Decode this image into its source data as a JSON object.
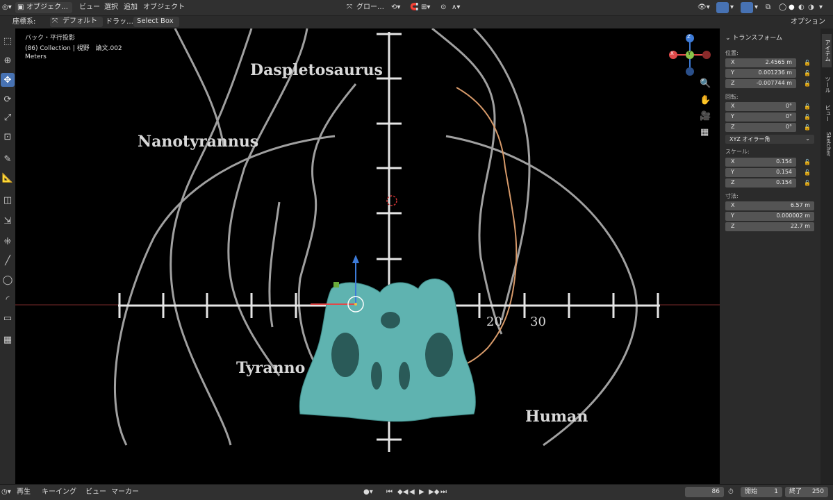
{
  "header": {
    "mode": "オブジェク…",
    "menus": [
      "ビュー",
      "選択",
      "追加",
      "オブジェクト"
    ],
    "transform_orientation": "グロー…"
  },
  "toolheader": {
    "coord_label": "座標系:",
    "orientation": "デフォルト",
    "drag_label": "ドラッ…",
    "select_mode": "Select Box",
    "options": "オプション"
  },
  "viewport": {
    "view_name": "バック・平行投影",
    "collection": "(86) Collection | 視野　論文.002",
    "units": "Meters",
    "image_labels": {
      "daspletosaurus": "Daspletosaurus",
      "nanotyrannus": "Nanotyrannus",
      "tyrannosaurus": "Tyranno",
      "human": "Human",
      "tick20": "20",
      "tick30": "30"
    },
    "gizmo": {
      "x": "X",
      "y": "Y",
      "z": "Z"
    }
  },
  "sidebar": {
    "panel_title": "トランスフォーム",
    "location_label": "位置:",
    "location": [
      {
        "axis": "X",
        "value": "2.4565 m"
      },
      {
        "axis": "Y",
        "value": "0.001236 m"
      },
      {
        "axis": "Z",
        "value": "-0.007744 m"
      }
    ],
    "rotation_label": "回転:",
    "rotation": [
      {
        "axis": "X",
        "value": "0°"
      },
      {
        "axis": "Y",
        "value": "0°"
      },
      {
        "axis": "Z",
        "value": "0°"
      }
    ],
    "rotation_mode": "XYZ オイラー角",
    "scale_label": "スケール:",
    "scale": [
      {
        "axis": "X",
        "value": "0.154"
      },
      {
        "axis": "Y",
        "value": "0.154"
      },
      {
        "axis": "Z",
        "value": "0.154"
      }
    ],
    "dimensions_label": "寸法:",
    "dimensions": [
      {
        "axis": "X",
        "value": "6.57 m"
      },
      {
        "axis": "Y",
        "value": "0.000002 m"
      },
      {
        "axis": "Z",
        "value": "22.7 m"
      }
    ]
  },
  "tabs": [
    "アイテム",
    "ツール",
    "ビュー",
    "Sketcher"
  ],
  "timeline": {
    "playback": "再生",
    "keying": "キーイング",
    "view": "ビュー",
    "marker": "マーカー",
    "current_frame": "86",
    "start_label": "開始",
    "start": "1",
    "end_label": "終了",
    "end": "250"
  },
  "colors": {
    "accent": "#4772b3",
    "mesh": "#5fb3b0",
    "curve": "#d79a6a"
  }
}
